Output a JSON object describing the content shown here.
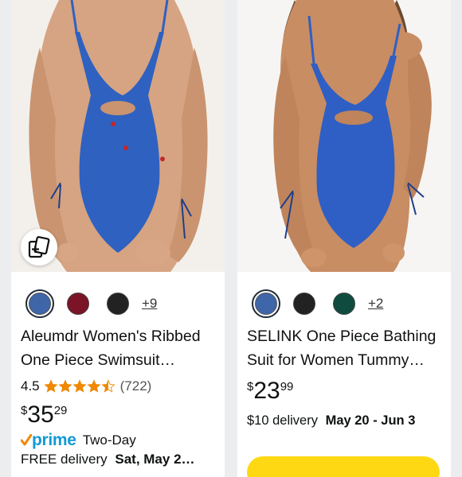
{
  "products": [
    {
      "title_line1": "Aleumdr Women's Ribbed",
      "title_line2": "One Piece Swimsuit…",
      "rating": "4.5",
      "rating_count": "(722)",
      "stars": 4.5,
      "price_symbol": "$",
      "price_whole": "35",
      "price_fraction": "29",
      "prime_label": "prime",
      "prime_speed": "Two-Day",
      "free_delivery_prefix": "FREE delivery",
      "free_delivery_date": "Sat, May 2…",
      "more_colors": "+9",
      "swatches": [
        "#3e66a8",
        "#7a1426",
        "#222222"
      ],
      "swimsuit_color": "#2f61c0",
      "compare_icon": "add-to-compare-icon"
    },
    {
      "title_line1": "SELINK One Piece Bathing",
      "title_line2": "Suit for Women Tummy…",
      "price_symbol": "$",
      "price_whole": "23",
      "price_fraction": "99",
      "delivery_fee": "$10 delivery",
      "delivery_dates": "May 20 - Jun 3",
      "more_colors": "+2",
      "swatches": [
        "#3e66a8",
        "#222222",
        "#0f4c3f"
      ],
      "swimsuit_color": "#2f5fc4"
    }
  ],
  "colors": {
    "star": "#f08804",
    "prime_blue": "#1399d6",
    "cart_yellow": "#ffd814"
  }
}
